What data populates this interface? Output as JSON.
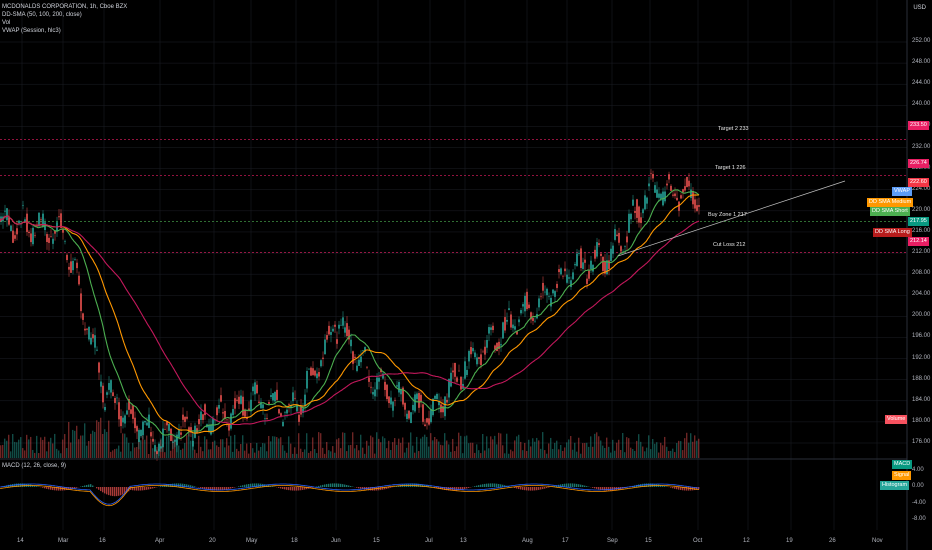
{
  "legend": {
    "symbol": "MCDONALDS CORPORATION, 1h, Cboe BZX",
    "sma": "DD-SMA (50, 100, 200, close)",
    "vol": "Vol",
    "vwap": "VWAP (Session, hlc3)"
  },
  "currency": "USD",
  "price_axis": [
    "252.00",
    "248.00",
    "244.00",
    "240.00",
    "236.00",
    "232.00",
    "228.00",
    "224.00",
    "220.00",
    "216.00",
    "212.00",
    "208.00",
    "204.00",
    "200.00",
    "196.00",
    "192.00",
    "188.00",
    "184.00",
    "180.00",
    "176.00"
  ],
  "macd_axis": [
    "4.00",
    "0.00",
    "-4.00",
    "-8.00"
  ],
  "time_axis": [
    "14",
    "Mar",
    "16",
    "Apr",
    "20",
    "May",
    "18",
    "Jun",
    "15",
    "Jul",
    "13",
    "Aug",
    "17",
    "Sep",
    "15",
    "Oct",
    "12",
    "19",
    "26",
    "Nov"
  ],
  "macd_label": "MACD (12, 26, close, 9)",
  "price_tags": [
    {
      "text": "233.50",
      "color": "#e91e63"
    },
    {
      "text": "226.74",
      "color": "#e91e63"
    },
    {
      "text": "222.60",
      "color": "#f23645"
    },
    {
      "text": "VWAP",
      "color": "#5b9cf6"
    },
    {
      "text": "DD SMA Medium",
      "color": "#ff9800"
    },
    {
      "text": "DD SMA Short",
      "color": "#4caf50"
    },
    {
      "text": "217.95",
      "color": "#089981"
    },
    {
      "text": "DD SMA Long",
      "color": "#b71c1c"
    },
    {
      "text": "212.14",
      "color": "#e91e63"
    },
    {
      "text": "Volume",
      "color": "#f7525f"
    },
    {
      "text": "MACD",
      "color": "#089981"
    },
    {
      "text": "Signal",
      "color": "#ff9800"
    },
    {
      "text": "Histogram",
      "color": "#26a69a"
    }
  ],
  "annotations": {
    "target2": "Target 2 233",
    "target1": "Target 1 226",
    "buy_zone": "Buy Zone 1 217",
    "cut_loss": "Cut Loss 212"
  },
  "colors": {
    "up": "#26a69a",
    "down": "#ef5350",
    "sma_short": "#4caf50",
    "sma_medium": "#ff9800",
    "sma_long": "#c2185b",
    "level": "#e91e63",
    "buy_zone": "#4caf50"
  },
  "chart_data": {
    "type": "line",
    "title": "MCDONALDS CORPORATION, 1h, Cboe BZX",
    "ylabel": "USD",
    "ylim": [
      175,
      254
    ],
    "levels": [
      233.5,
      226.74,
      217.95,
      212.14
    ],
    "series": [
      {
        "name": "MCDONALDS CORPORATION",
        "x": [
          "14",
          "Mar",
          "16",
          "Apr",
          "20",
          "May",
          "18",
          "Jun",
          "15",
          "Jul",
          "13",
          "Aug",
          "17",
          "Sep",
          "15",
          "Oct"
        ],
        "values": [
          218,
          216,
          186,
          176,
          181,
          184,
          182,
          199,
          187,
          181,
          191,
          201,
          208,
          212,
          224,
          222.6
        ]
      }
    ]
  }
}
